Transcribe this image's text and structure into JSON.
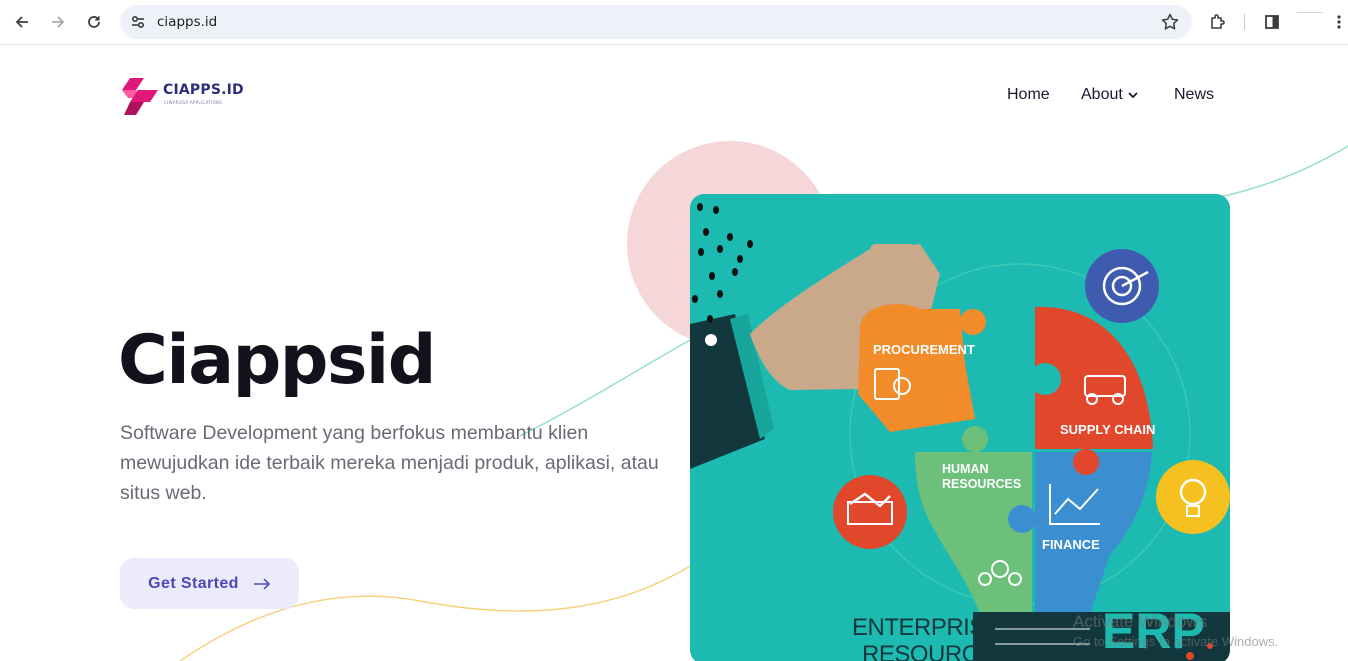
{
  "browser": {
    "url": "ciapps.id",
    "icons": [
      "back-icon",
      "forward-icon",
      "reload-icon",
      "site-settings-icon",
      "bookmark-star-icon",
      "extensions-icon",
      "side-panel-icon",
      "more-menu-icon"
    ]
  },
  "site": {
    "logo_text": "CIAPPS.ID",
    "logo_tagline": "CIWARUGA APPLICATIONS",
    "nav": {
      "home": "Home",
      "about": "About",
      "news": "News"
    }
  },
  "hero": {
    "title": "Ciappsid",
    "description": "Software Development yang berfokus membantu klien mewujudkan ide terbaik mereka menjadi produk, aplikasi, atau situs web.",
    "cta_label": "Get Started"
  },
  "illustration": {
    "procurement": "PROCUREMENT",
    "supply_chain": "SUPPLY CHAIN",
    "human_resources_1": "HUMAN",
    "human_resources_2": "RESOURCES",
    "finance": "FINANCE",
    "erp_line1": "ENTERPRISE",
    "erp_line2": "RESOURCE",
    "erp_abbrev": "ERP",
    "colors": {
      "background": "#1dbab1",
      "orange": "#f28c2b",
      "red": "#e0472b",
      "green": "#6cc07a",
      "blue": "#3b8fd0",
      "dark_blue": "#3e5bb0",
      "yellow": "#f5c120"
    }
  },
  "watermark": {
    "line1": "Activate Windows",
    "line2": "Go to Settings to activate Windows."
  },
  "colors": {
    "accent": "#4e46b8",
    "cta_bg": "#ecebfb",
    "logo_pink": "#e0187a",
    "logo_navy": "#2e2f7a"
  }
}
